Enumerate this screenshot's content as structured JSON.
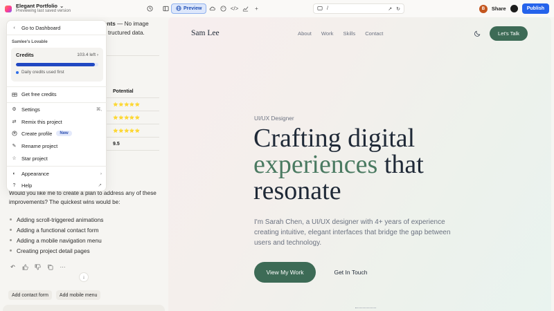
{
  "topbar": {
    "project_title": "Elegant Portfolio",
    "project_subtitle": "Previewing last saved version",
    "preview_label": "Preview",
    "url_path": "/",
    "avatar_initial": "B",
    "share_label": "Share",
    "publish_label": "Publish"
  },
  "chat": {
    "line1_bold": "ents",
    "line1_rest": " — No image",
    "line2": "tructured data.",
    "table": {
      "header": "Potential",
      "rows": [
        "⭐⭐⭐⭐⭐",
        "⭐⭐⭐⭐⭐",
        "⭐⭐⭐⭐⭐",
        "9.5"
      ]
    },
    "question_line1": "Would you like me to create a plan to address any of these",
    "question_line2": "improvements? The quickest wins would be:",
    "bullets": [
      "Adding scroll-triggered animations",
      "Adding a functional contact form",
      "Adding a mobile navigation menu",
      "Creating project detail pages"
    ],
    "chips": [
      "Add contact form",
      "Add mobile menu"
    ]
  },
  "menu": {
    "back_label": "Go to Dashboard",
    "workspace_label": "Samlee's Lovable",
    "credits_title": "Credits",
    "credits_left": "103.4 left",
    "credits_fill_percent": 96,
    "credits_note": "Daily credits used first",
    "get_free_credits": "Get free credits",
    "settings": "Settings",
    "settings_shortcut": "⌘,",
    "remix": "Remix this project",
    "create_profile": "Create profile",
    "new_badge": "New",
    "rename": "Rename project",
    "star": "Star project",
    "appearance": "Appearance",
    "help": "Help"
  },
  "site": {
    "logo": "Sam Lee",
    "nav": [
      "About",
      "Work",
      "Skills",
      "Contact"
    ],
    "talk_button": "Let's Talk",
    "eyebrow": "UI/UX Designer",
    "headline_line1": "Crafting digital",
    "headline_accent": "experiences",
    "headline_line2_rest": " that",
    "headline_line3": "resonate",
    "lead": "I'm Sarah Chen, a UI/UX designer with 4+ years of experience creating intuitive, elegant interfaces that bridge the gap between users and technology.",
    "cta_primary": "View My Work",
    "cta_secondary": "Get In Touch"
  },
  "colors": {
    "accent_green": "#3d6b56",
    "publish_blue": "#2563eb",
    "credits_blue": "#2148c2"
  }
}
